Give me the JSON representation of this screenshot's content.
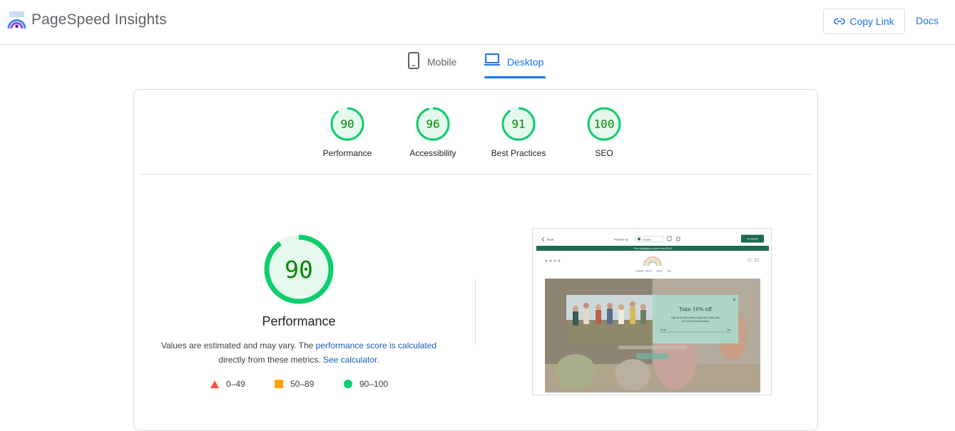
{
  "app": {
    "title": "PageSpeed Insights"
  },
  "header": {
    "copy_link_label": "Copy Link",
    "docs_label": "Docs"
  },
  "tabs": [
    {
      "label": "Mobile",
      "active": false,
      "icon": "phone-icon"
    },
    {
      "label": "Desktop",
      "active": true,
      "icon": "laptop-icon"
    }
  ],
  "colors": {
    "accent": "#1a73e8",
    "pass": "#0cce6b",
    "pass_text": "#008800",
    "pass_fill": "#e6f9ee",
    "average": "#ffa400",
    "fail": "#ff4e42"
  },
  "scores": [
    {
      "label": "Performance",
      "value": "90",
      "fraction": 0.9
    },
    {
      "label": "Accessibility",
      "value": "96",
      "fraction": 0.96
    },
    {
      "label": "Best Practices",
      "value": "91",
      "fraction": 0.91
    },
    {
      "label": "SEO",
      "value": "100",
      "fraction": 1.0
    }
  ],
  "main": {
    "score": "90",
    "score_fraction": 0.9,
    "title": "Performance",
    "desc_1": "Values are estimated and may vary. The ",
    "desc_link_1": "performance score is calculated",
    "desc_2": " directly from these metrics. ",
    "desc_link_2": "See calculator."
  },
  "legend": [
    {
      "shape": "triangle",
      "label": "0–49"
    },
    {
      "shape": "square",
      "label": "50–89"
    },
    {
      "shape": "circle",
      "label": "90–100"
    }
  ],
  "screenshot": {
    "back": "Back",
    "preview_label": "Preview as",
    "language": "English",
    "cta": "Try theme",
    "banner": "Free shipping on orders over $100",
    "nav": [
      "Catalog",
      "About",
      "Blog",
      "Talk"
    ],
    "popup_title": "Take 10% off",
    "popup_body_1": "Sign up for early access, discounts & more, plus",
    "popup_body_2": "10% off your first purchase.",
    "popup_email": "Email",
    "popup_submit": "Join"
  }
}
